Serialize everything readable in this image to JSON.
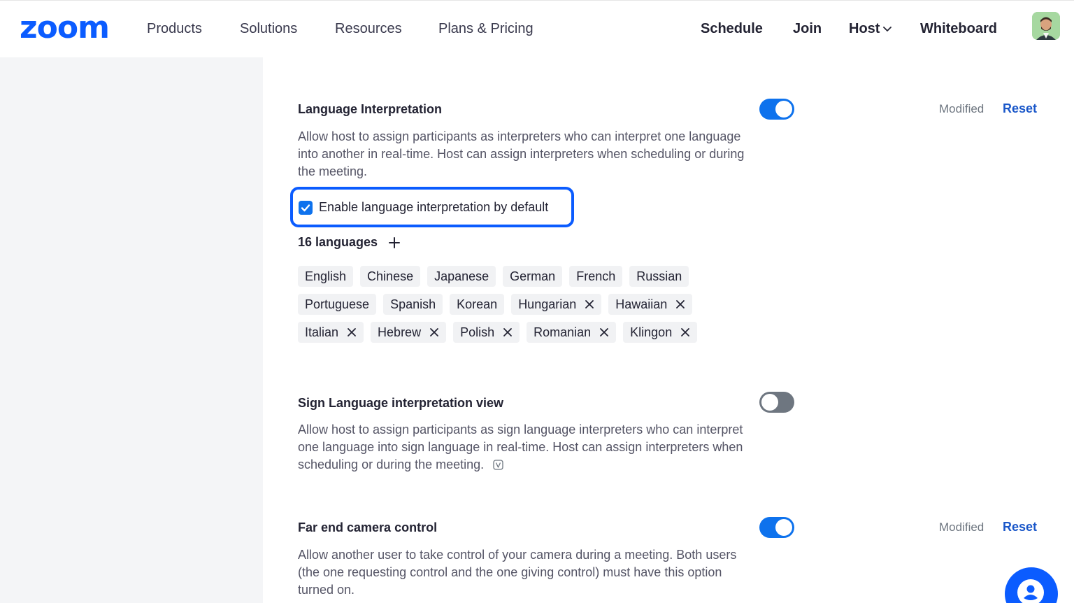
{
  "nav": {
    "brand": "zoom",
    "left_links": [
      "Products",
      "Solutions",
      "Resources",
      "Plans & Pricing"
    ],
    "schedule": "Schedule",
    "join": "Join",
    "host": "Host",
    "whiteboard": "Whiteboard",
    "avatar_icon": "user-avatar"
  },
  "colors": {
    "accent": "#0e72ed",
    "brand": "#0b5cff",
    "reset_link": "#1a57c9",
    "toggle_off": "#6e7680"
  },
  "sections": {
    "language": {
      "title": "Language Interpretation",
      "description": "Allow host to assign participants as interpreters who can interpret one language into another in real-time. Host can assign interpreters when scheduling or during the meeting.",
      "toggle_on": true,
      "modified": "Modified",
      "reset": "Reset",
      "default_checkbox_label": "Enable language interpretation by default",
      "default_checkbox_checked": true,
      "languages_count": "16 languages",
      "language_rows": [
        [
          {
            "name": "English",
            "removable": false
          },
          {
            "name": "Chinese",
            "removable": false
          },
          {
            "name": "Japanese",
            "removable": false
          },
          {
            "name": "German",
            "removable": false
          },
          {
            "name": "French",
            "removable": false
          },
          {
            "name": "Russian",
            "removable": false
          }
        ],
        [
          {
            "name": "Portuguese",
            "removable": false
          },
          {
            "name": "Spanish",
            "removable": false
          },
          {
            "name": "Korean",
            "removable": false
          },
          {
            "name": "Hungarian",
            "removable": true
          },
          {
            "name": "Hawaiian",
            "removable": true
          }
        ],
        [
          {
            "name": "Italian",
            "removable": true
          },
          {
            "name": "Hebrew",
            "removable": true
          },
          {
            "name": "Polish",
            "removable": true
          },
          {
            "name": "Romanian",
            "removable": true
          },
          {
            "name": "Klingon",
            "removable": true
          }
        ]
      ]
    },
    "sign_language": {
      "title": "Sign Language interpretation view",
      "description": "Allow host to assign participants as sign language interpreters who can interpret one language into sign language in real-time. Host can assign interpreters when scheduling or during the meeting.",
      "toggle_on": false
    },
    "far_end_camera": {
      "title": "Far end camera control",
      "description": "Allow another user to take control of your camera during a meeting. Both users (the one requesting control and the one giving control) must have this option turned on.",
      "toggle_on": true,
      "modified": "Modified",
      "reset": "Reset"
    }
  }
}
